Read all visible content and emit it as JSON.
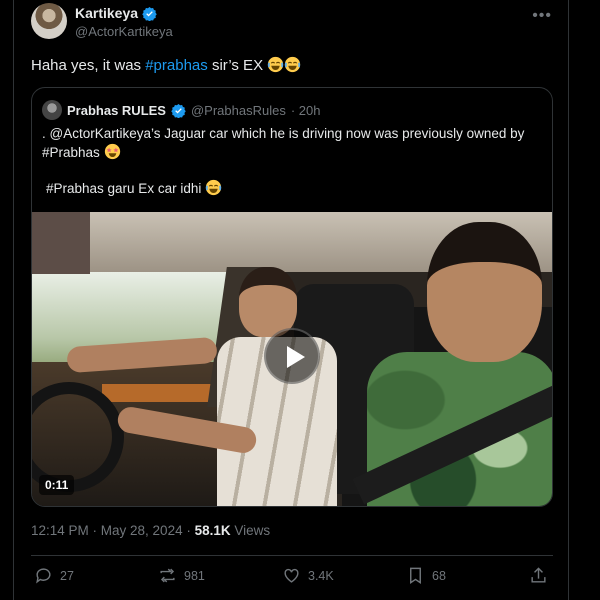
{
  "author": {
    "name": "Kartikeya",
    "handle": "@ActorKartikeya",
    "verified_color": "#1d9bf0"
  },
  "more_menu": "•••",
  "tweet": {
    "text_before": "Haha yes, it was ",
    "hashtag": "#prabhas",
    "text_after": " sir’s EX",
    "emojis": [
      "joy-emoji",
      "joy-emoji"
    ]
  },
  "quote": {
    "name": "Prabhas RULES",
    "handle": "@PrabhasRules",
    "time": "· 20h",
    "line1": ". @ActorKartikeya’s  Jaguar car which he is driving now was previously owned by #Prabhas",
    "line1_emoji": "star-struck-emoji",
    "line2": "#Prabhas garu Ex car idhi",
    "line2_emoji": "joy-emoji",
    "video": {
      "duration": "0:11",
      "play_icon": "play-icon"
    }
  },
  "meta": {
    "timestamp": "12:14 PM · May 28, 2024 · ",
    "views_count": "58.1K",
    "views_label": " Views"
  },
  "actions": {
    "replies": "27",
    "reposts": "981",
    "likes": "3.4K",
    "bookmarks": "68"
  },
  "colors": {
    "background": "#000000",
    "accent": "#1d9bf0",
    "text": "#e7e9ea",
    "muted": "#71767b",
    "border": "#2f3336"
  }
}
